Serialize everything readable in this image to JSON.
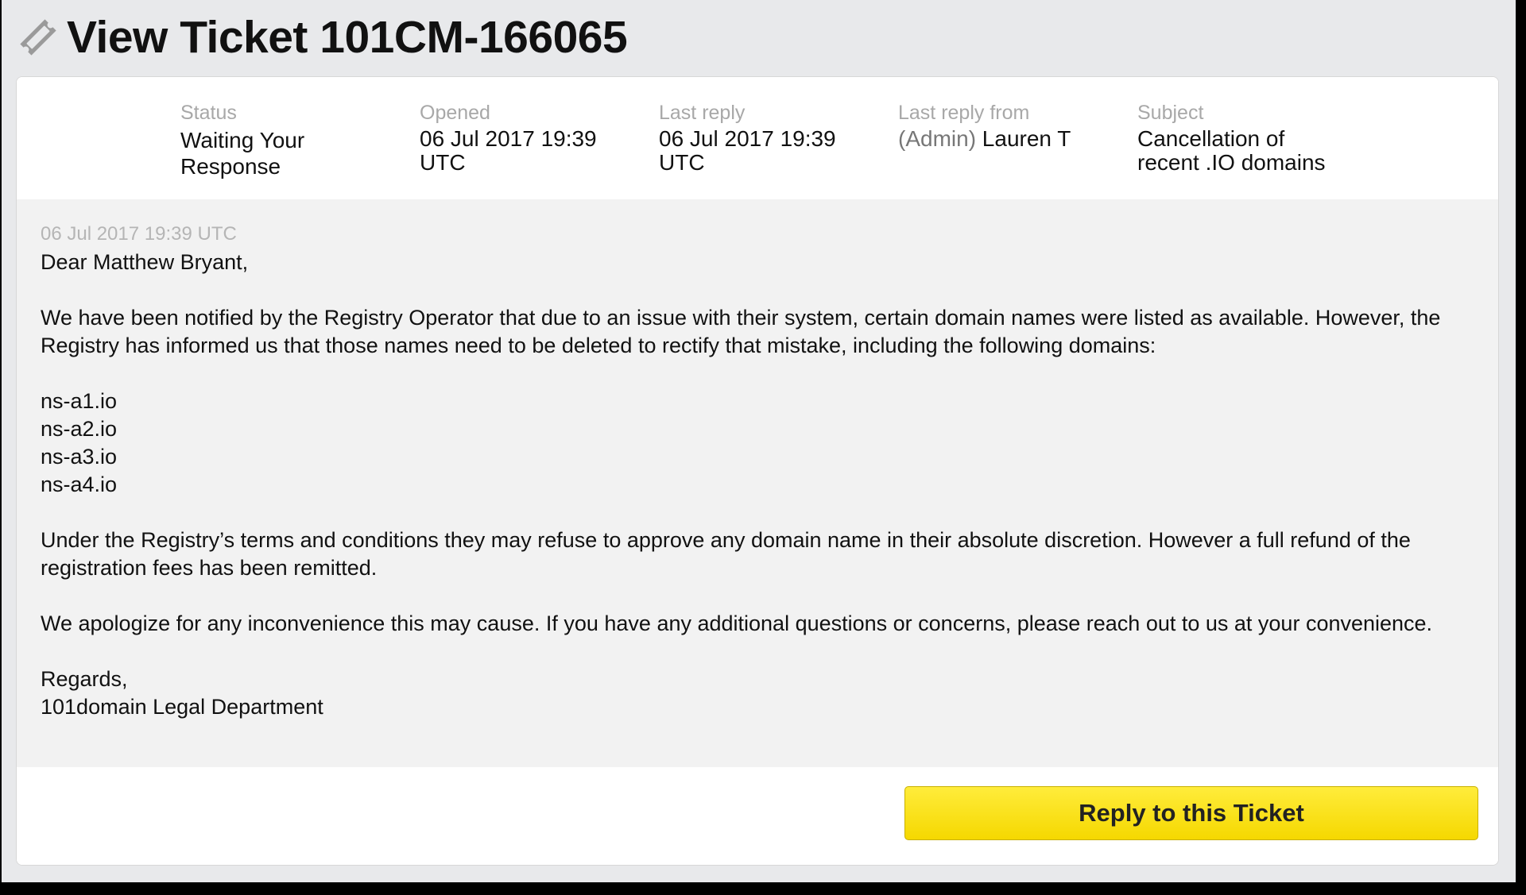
{
  "header": {
    "icon": "ticket-icon",
    "title": "View Ticket 101CM-166065"
  },
  "meta": {
    "status": {
      "label": "Status",
      "value": "Waiting Your Response"
    },
    "opened": {
      "label": "Opened",
      "value": "06 Jul 2017 19:39 UTC"
    },
    "last_reply": {
      "label": "Last reply",
      "value": "06 Jul 2017 19:39 UTC"
    },
    "last_reply_from": {
      "label": "Last reply from",
      "role": "(Admin)",
      "name": "Lauren T"
    },
    "subject": {
      "label": "Subject",
      "value": "Cancellation of recent .IO domains"
    }
  },
  "message": {
    "date": "06 Jul 2017 19:39 UTC",
    "greeting": "Dear Matthew Bryant,",
    "para1": "We have been notified by the Registry Operator that due to an issue with their system, certain domain names were listed as available. However, the Registry has informed us that those names need to be deleted to rectify that mistake, including the following domains:",
    "domains": [
      "ns-a1.io",
      "ns-a2.io",
      "ns-a3.io",
      "ns-a4.io"
    ],
    "para2": "Under the Registry’s terms and conditions they may refuse to approve any domain name in their absolute discretion. However a full refund of the registration fees has been remitted.",
    "para3": "We apologize for any inconvenience this may cause. If you have any additional questions or concerns, please reach out to us at your convenience.",
    "closing": "Regards,",
    "signature": "101domain Legal Department"
  },
  "footer": {
    "reply_label": "Reply to this Ticket"
  },
  "colors": {
    "button_yellow": "#ffe600",
    "background": "#e8e9eb",
    "message_bg": "#f2f2f2",
    "label_gray": "#a8a8a8"
  }
}
